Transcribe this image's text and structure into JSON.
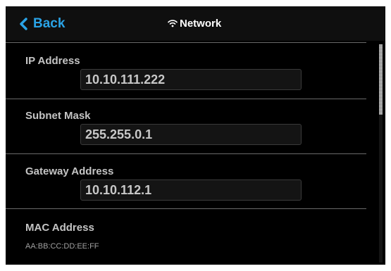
{
  "header": {
    "back_label": "Back",
    "title": "Network"
  },
  "fields": {
    "ip": {
      "label": "IP Address",
      "value": "10.10.111.222"
    },
    "subnet": {
      "label": "Subnet Mask",
      "value": "255.255.0.1"
    },
    "gateway": {
      "label": "Gateway Address",
      "value": "10.10.112.1"
    }
  },
  "mac": {
    "label": "MAC Address",
    "value": "AA:BB:CC:DD:EE:FF"
  },
  "colors": {
    "accent": "#2aa3e6",
    "background": "#000000",
    "text": "#c4c4c4"
  },
  "icons": [
    "chevron-left-icon",
    "wifi-icon"
  ]
}
